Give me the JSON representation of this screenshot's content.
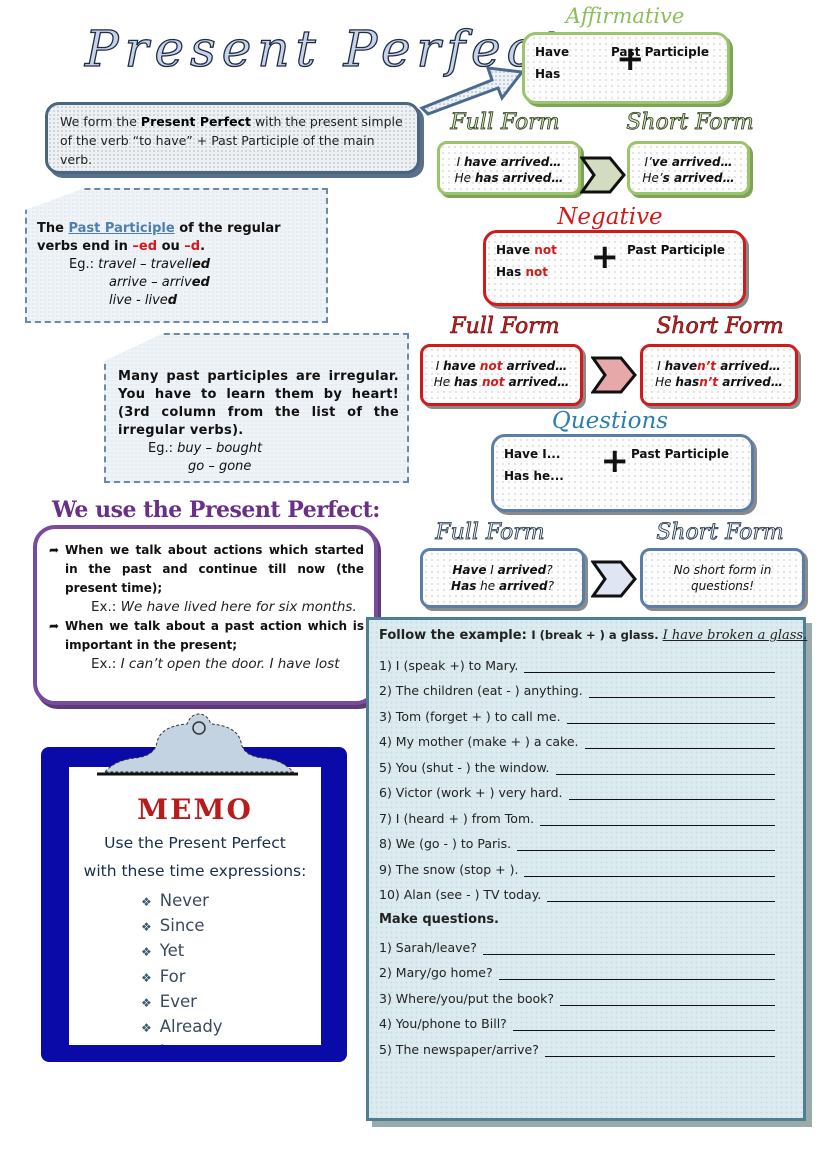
{
  "title": "Present Perfect",
  "intro": {
    "pre": "We form the ",
    "bold": "Present Perfect",
    "post": " with the present simple of the verb “to have” + Past Participle of the main verb."
  },
  "affirmative": {
    "label": "Affirmative",
    "color": "#8bbf5a",
    "line1": "Have",
    "line2": "Has",
    "plus": "+",
    "participle": "Past Participle",
    "full_label": "Full Form",
    "short_label": "Short Form",
    "full": [
      {
        "a": "I ",
        "b": "have arrived…"
      },
      {
        "a": "He ",
        "b": "has arrived…"
      }
    ],
    "short": [
      {
        "a": "I’",
        "b": "ve arrived…"
      },
      {
        "a": "He’",
        "b": "s arrived…"
      }
    ]
  },
  "negative": {
    "label": "Negative",
    "color": "#d21a1a",
    "line1": "Have ",
    "line1_not": "not",
    "line2": "Has ",
    "line2_not": "not",
    "plus": "+",
    "participle": "Past Participle",
    "full_label": "Full Form",
    "short_label": "Short Form",
    "full": [
      {
        "a": "I ",
        "b": "have ",
        "n": "not",
        "c": " arrived…"
      },
      {
        "a": "He ",
        "b": "has ",
        "n": "not",
        "c": " arrived…"
      }
    ],
    "short": [
      {
        "a": "I ",
        "b": "have",
        "n": "n’t",
        "c": " arrived…"
      },
      {
        "a": "He ",
        "b": "has",
        "n": "n’t",
        "c": " arrived…"
      }
    ]
  },
  "questions": {
    "label": "Questions",
    "color": "#2b7fb0",
    "line1": "Have I...",
    "line2": "Has he...",
    "plus": "+",
    "participle": "Past Participle",
    "full_label": "Full Form",
    "short_label": "Short Form",
    "full": [
      {
        "a": "Have",
        "b": " I ",
        "c": "arrived",
        "d": "?"
      },
      {
        "a": "Has",
        "b": " he ",
        "c": "arrived",
        "d": "?"
      }
    ],
    "short": "No short form in questions!"
  },
  "regular_note": {
    "t1": "The ",
    "link": "Past Participle",
    "t2": " of the regular verbs end in ",
    "ed": "–ed",
    "ou": " ou ",
    "d": "–d",
    "dot": ".",
    "eg": "Eg.: ",
    "examples": [
      {
        "base": "travel – travell",
        "end": "ed"
      },
      {
        "base": "arrive – arriv",
        "end": "ed"
      },
      {
        "base": "live - live",
        "end": "d"
      }
    ]
  },
  "irregular_note": {
    "text": "Many past participles are irregular. You have to learn them by heart! (3rd column from the list of the irregular verbs).",
    "eg": "Eg.: ",
    "examples": [
      "buy – bought",
      "go – gone"
    ]
  },
  "use": {
    "title": "We use the Present Perfect:",
    "items": [
      {
        "text": "When we talk about actions which started in the past and continue till now (the present time);",
        "ex_label": "Ex.: ",
        "ex": "We have lived here for six months."
      },
      {
        "text": "When we talk about a past action which is important in the present;",
        "ex_label": "Ex.: ",
        "ex": "I can’t open the door. I have lost"
      }
    ]
  },
  "memo": {
    "title": "MEMO",
    "subtitle1": "Use the Present Perfect",
    "subtitle2": "with these time expressions:",
    "items": [
      "Never",
      "Since",
      "Yet",
      "For",
      "Ever",
      "Already",
      "Just"
    ]
  },
  "exercise": {
    "header": "Follow the example: ",
    "example": "I (break + ) a glass.",
    "answer": "I have broken a glass.",
    "items": [
      "1)  I (speak +) to Mary.",
      "2)  The children (eat - ) anything.",
      "3)  Tom (forget + ) to call me.",
      "4)  My mother (make + ) a cake.",
      "5)  You (shut - ) the window.",
      "6)  Victor (work + ) very hard.",
      "7)  I (heard + ) from Tom.",
      "8)  We (go - ) to Paris.",
      "9)  The snow (stop + ).",
      "10)  Alan (see - ) TV today."
    ],
    "questions_header": "Make questions.",
    "questions": [
      "1) Sarah/leave?",
      "2) Mary/go home?",
      "3) Where/you/put the book?",
      "4) You/phone to Bill?",
      "5) The newspaper/arrive?"
    ]
  }
}
